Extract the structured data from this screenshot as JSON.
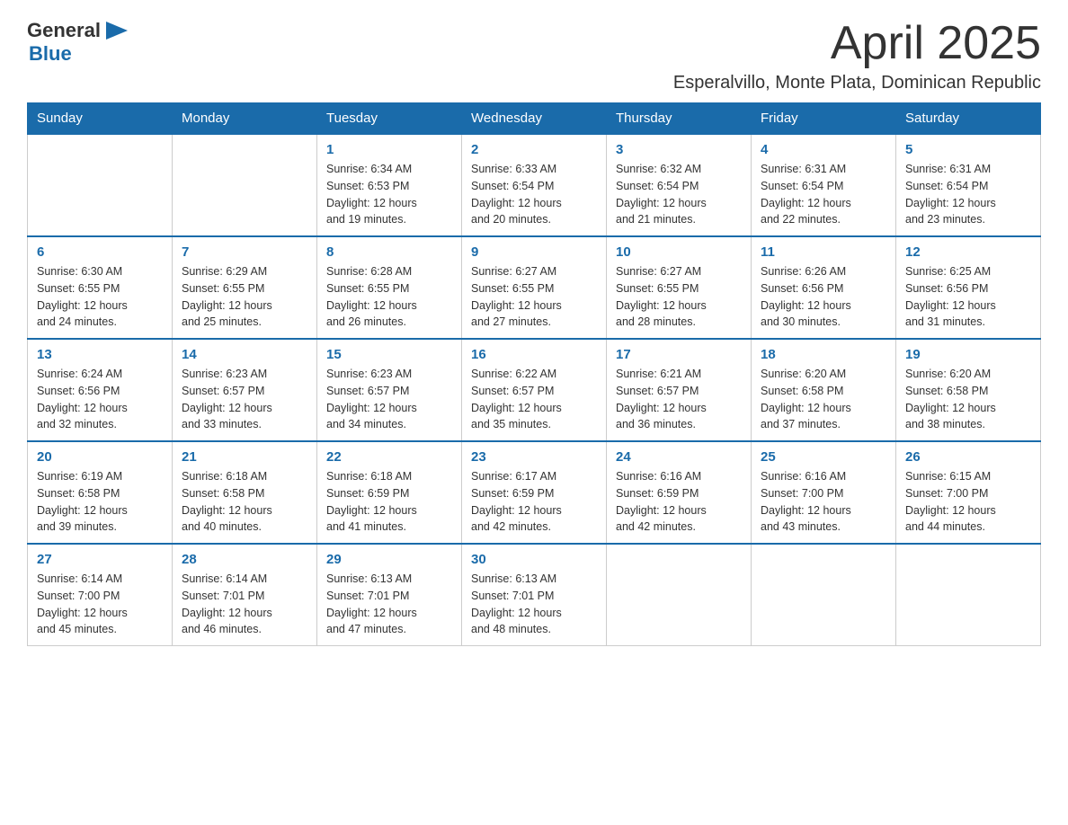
{
  "header": {
    "logo_general": "General",
    "logo_blue": "Blue",
    "month": "April 2025",
    "location": "Esperalvillo, Monte Plata, Dominican Republic"
  },
  "weekdays": [
    "Sunday",
    "Monday",
    "Tuesday",
    "Wednesday",
    "Thursday",
    "Friday",
    "Saturday"
  ],
  "weeks": [
    [
      {
        "day": "",
        "info": ""
      },
      {
        "day": "",
        "info": ""
      },
      {
        "day": "1",
        "info": "Sunrise: 6:34 AM\nSunset: 6:53 PM\nDaylight: 12 hours\nand 19 minutes."
      },
      {
        "day": "2",
        "info": "Sunrise: 6:33 AM\nSunset: 6:54 PM\nDaylight: 12 hours\nand 20 minutes."
      },
      {
        "day": "3",
        "info": "Sunrise: 6:32 AM\nSunset: 6:54 PM\nDaylight: 12 hours\nand 21 minutes."
      },
      {
        "day": "4",
        "info": "Sunrise: 6:31 AM\nSunset: 6:54 PM\nDaylight: 12 hours\nand 22 minutes."
      },
      {
        "day": "5",
        "info": "Sunrise: 6:31 AM\nSunset: 6:54 PM\nDaylight: 12 hours\nand 23 minutes."
      }
    ],
    [
      {
        "day": "6",
        "info": "Sunrise: 6:30 AM\nSunset: 6:55 PM\nDaylight: 12 hours\nand 24 minutes."
      },
      {
        "day": "7",
        "info": "Sunrise: 6:29 AM\nSunset: 6:55 PM\nDaylight: 12 hours\nand 25 minutes."
      },
      {
        "day": "8",
        "info": "Sunrise: 6:28 AM\nSunset: 6:55 PM\nDaylight: 12 hours\nand 26 minutes."
      },
      {
        "day": "9",
        "info": "Sunrise: 6:27 AM\nSunset: 6:55 PM\nDaylight: 12 hours\nand 27 minutes."
      },
      {
        "day": "10",
        "info": "Sunrise: 6:27 AM\nSunset: 6:55 PM\nDaylight: 12 hours\nand 28 minutes."
      },
      {
        "day": "11",
        "info": "Sunrise: 6:26 AM\nSunset: 6:56 PM\nDaylight: 12 hours\nand 30 minutes."
      },
      {
        "day": "12",
        "info": "Sunrise: 6:25 AM\nSunset: 6:56 PM\nDaylight: 12 hours\nand 31 minutes."
      }
    ],
    [
      {
        "day": "13",
        "info": "Sunrise: 6:24 AM\nSunset: 6:56 PM\nDaylight: 12 hours\nand 32 minutes."
      },
      {
        "day": "14",
        "info": "Sunrise: 6:23 AM\nSunset: 6:57 PM\nDaylight: 12 hours\nand 33 minutes."
      },
      {
        "day": "15",
        "info": "Sunrise: 6:23 AM\nSunset: 6:57 PM\nDaylight: 12 hours\nand 34 minutes."
      },
      {
        "day": "16",
        "info": "Sunrise: 6:22 AM\nSunset: 6:57 PM\nDaylight: 12 hours\nand 35 minutes."
      },
      {
        "day": "17",
        "info": "Sunrise: 6:21 AM\nSunset: 6:57 PM\nDaylight: 12 hours\nand 36 minutes."
      },
      {
        "day": "18",
        "info": "Sunrise: 6:20 AM\nSunset: 6:58 PM\nDaylight: 12 hours\nand 37 minutes."
      },
      {
        "day": "19",
        "info": "Sunrise: 6:20 AM\nSunset: 6:58 PM\nDaylight: 12 hours\nand 38 minutes."
      }
    ],
    [
      {
        "day": "20",
        "info": "Sunrise: 6:19 AM\nSunset: 6:58 PM\nDaylight: 12 hours\nand 39 minutes."
      },
      {
        "day": "21",
        "info": "Sunrise: 6:18 AM\nSunset: 6:58 PM\nDaylight: 12 hours\nand 40 minutes."
      },
      {
        "day": "22",
        "info": "Sunrise: 6:18 AM\nSunset: 6:59 PM\nDaylight: 12 hours\nand 41 minutes."
      },
      {
        "day": "23",
        "info": "Sunrise: 6:17 AM\nSunset: 6:59 PM\nDaylight: 12 hours\nand 42 minutes."
      },
      {
        "day": "24",
        "info": "Sunrise: 6:16 AM\nSunset: 6:59 PM\nDaylight: 12 hours\nand 42 minutes."
      },
      {
        "day": "25",
        "info": "Sunrise: 6:16 AM\nSunset: 7:00 PM\nDaylight: 12 hours\nand 43 minutes."
      },
      {
        "day": "26",
        "info": "Sunrise: 6:15 AM\nSunset: 7:00 PM\nDaylight: 12 hours\nand 44 minutes."
      }
    ],
    [
      {
        "day": "27",
        "info": "Sunrise: 6:14 AM\nSunset: 7:00 PM\nDaylight: 12 hours\nand 45 minutes."
      },
      {
        "day": "28",
        "info": "Sunrise: 6:14 AM\nSunset: 7:01 PM\nDaylight: 12 hours\nand 46 minutes."
      },
      {
        "day": "29",
        "info": "Sunrise: 6:13 AM\nSunset: 7:01 PM\nDaylight: 12 hours\nand 47 minutes."
      },
      {
        "day": "30",
        "info": "Sunrise: 6:13 AM\nSunset: 7:01 PM\nDaylight: 12 hours\nand 48 minutes."
      },
      {
        "day": "",
        "info": ""
      },
      {
        "day": "",
        "info": ""
      },
      {
        "day": "",
        "info": ""
      }
    ]
  ]
}
